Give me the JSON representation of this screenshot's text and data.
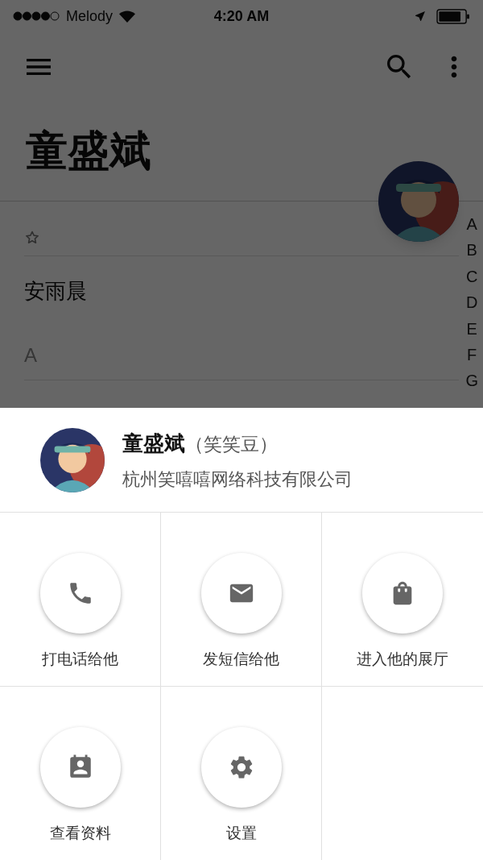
{
  "status_bar": {
    "carrier": "Melody",
    "time": "4:20 AM"
  },
  "header": {
    "title": "童盛斌"
  },
  "contact_list": [
    {
      "kind": "favorites",
      "entries": [
        "安雨晨"
      ]
    },
    {
      "kind": "letter",
      "header": "A"
    }
  ],
  "index_bar": [
    "A",
    "B",
    "C",
    "D",
    "E",
    "F",
    "G"
  ],
  "sheet": {
    "name": "童盛斌",
    "nickname": "（笑笑豆）",
    "company": "杭州笑嘻嘻网络科技有限公司",
    "actions": [
      {
        "kind": "phone",
        "label": "打电话给他"
      },
      {
        "kind": "message",
        "label": "发短信给他"
      },
      {
        "kind": "showroom",
        "label": "进入他的展厅"
      },
      {
        "kind": "profile",
        "label": "查看资料"
      },
      {
        "kind": "settings",
        "label": "设置"
      }
    ]
  }
}
